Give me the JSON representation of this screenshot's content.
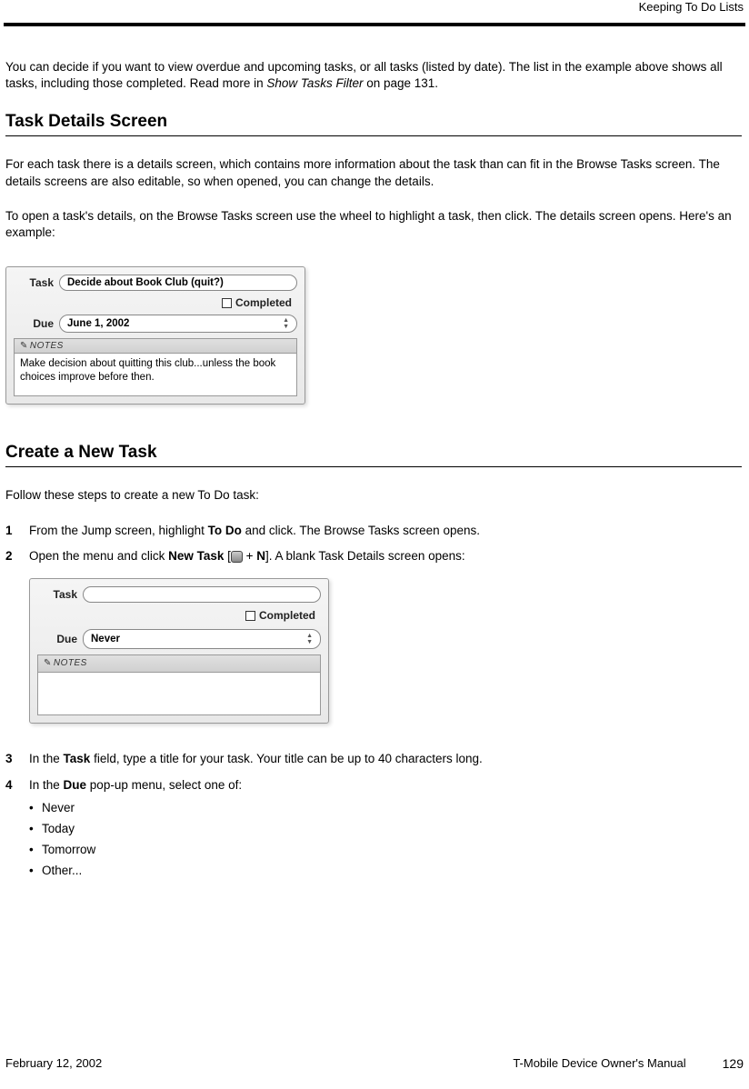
{
  "header": {
    "running_title": "Keeping To Do Lists"
  },
  "intro": {
    "p1_a": "You can decide if you want to view overdue and upcoming tasks, or all tasks (listed by date). The list in the example above shows all tasks, including those completed. Read more in ",
    "p1_link": "Show Tasks Filter",
    "p1_b": " on page 131."
  },
  "section1": {
    "title": "Task Details Screen",
    "p1": "For each task there is a details screen, which contains more information about the task than can fit in the Browse Tasks screen. The details screens are also editable, so when opened, you can change the details.",
    "p2": "To open a task's details, on the Browse Tasks screen use the wheel to highlight a task, then click. The details screen opens. Here's an example:",
    "screenshot": {
      "task_label": "Task",
      "task_value": "Decide about Book Club (quit?)",
      "completed_label": "Completed",
      "due_label": "Due",
      "due_value": "June 1, 2002",
      "notes_label": "NOTES",
      "notes_value": "Make decision about quitting this club...unless the book choices improve before then."
    }
  },
  "section2": {
    "title": "Create a New Task",
    "intro": "Follow these steps to create a new To Do task:",
    "steps": {
      "s1_a": "From the Jump screen, highlight ",
      "s1_b": "To Do",
      "s1_c": " and click. The Browse Tasks screen opens.",
      "s2_a": "Open the menu and click ",
      "s2_b": "New Task",
      "s2_c": " [",
      "s2_d": " + ",
      "s2_e": "N",
      "s2_f": "]. A blank Task Details screen opens:",
      "s3_a": "In the ",
      "s3_b": "Task",
      "s3_c": " field, type a title for your task. Your title can be up to 40 characters long.",
      "s4_a": "In the ",
      "s4_b": "Due",
      "s4_c": " pop-up menu, select one of:"
    },
    "screenshot": {
      "task_label": "Task",
      "task_value": "",
      "completed_label": "Completed",
      "due_label": "Due",
      "due_value": "Never",
      "notes_label": "NOTES",
      "notes_value": ""
    },
    "bullets": [
      "Never",
      "Today",
      "Tomorrow",
      "Other..."
    ]
  },
  "footer": {
    "date": "February 12, 2002",
    "manual": "T-Mobile Device Owner's Manual",
    "page": "129"
  }
}
